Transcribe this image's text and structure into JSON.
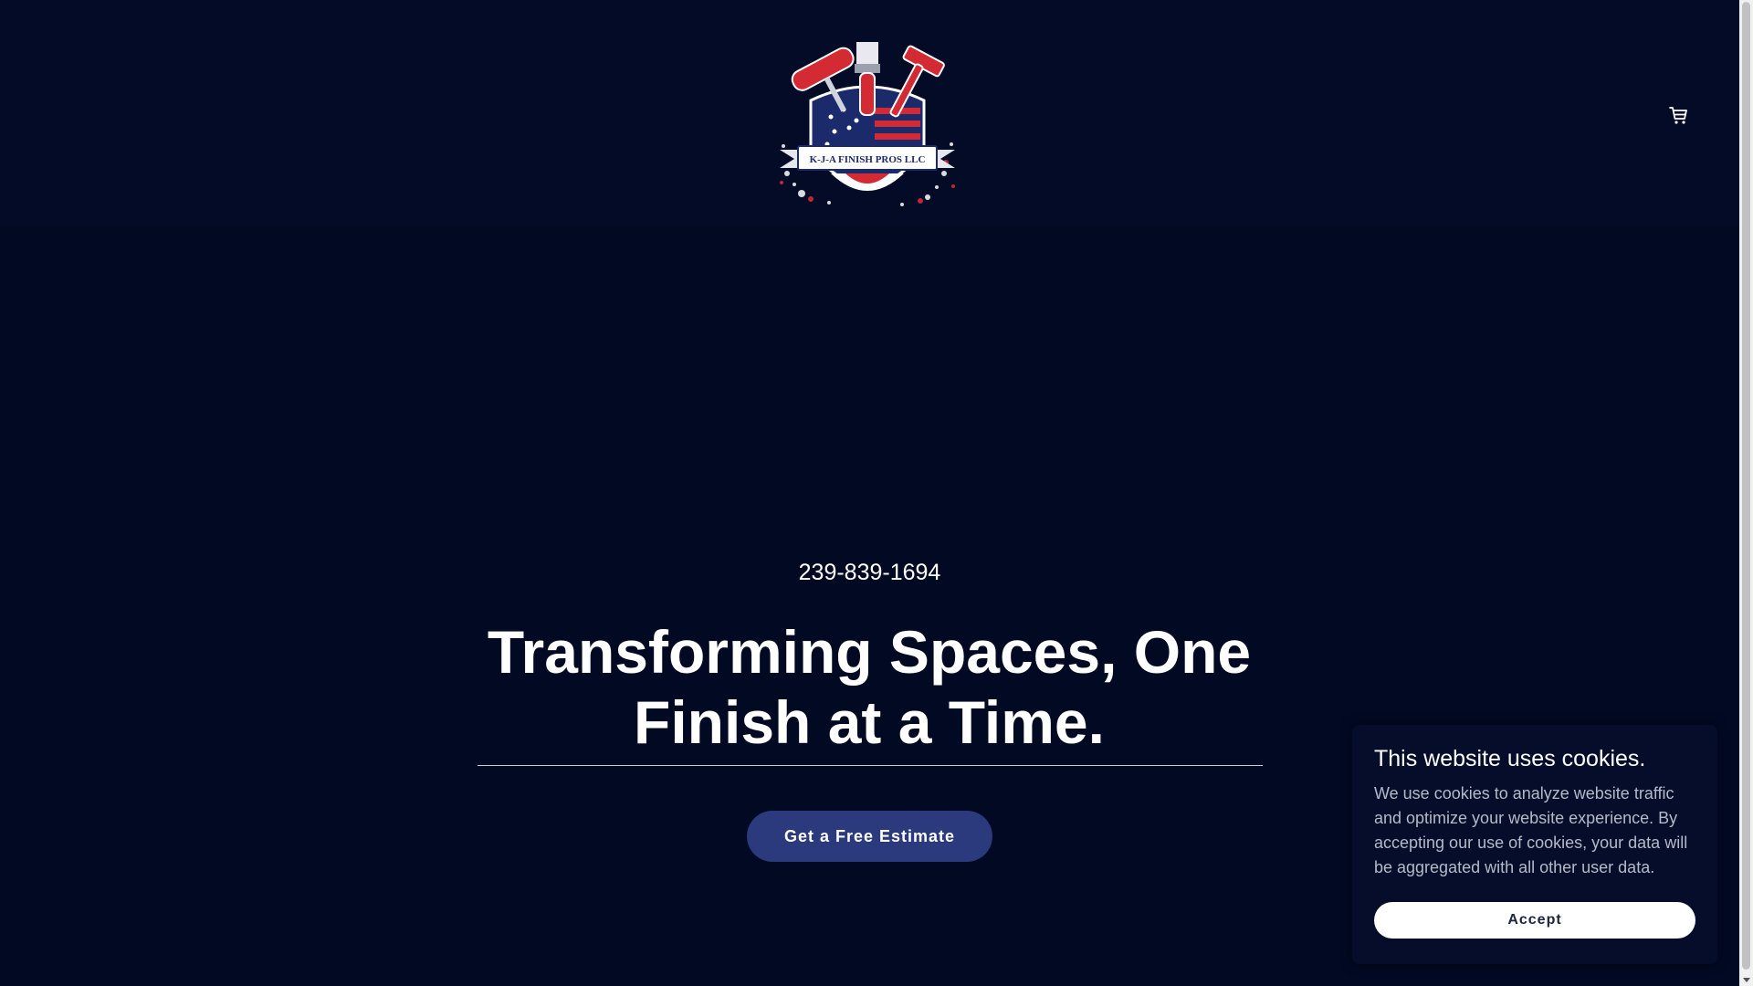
{
  "header": {
    "logo_text": "K-J-A FINISH PROS LLC",
    "cart_icon": "shopping-cart-icon"
  },
  "hero": {
    "phone": "239-839-1694",
    "headline": "Transforming Spaces, One Finish at a Time.",
    "cta_label": "Get a Free Estimate"
  },
  "cookie_banner": {
    "title": "This website uses cookies.",
    "text": "We use cookies to analyze website traffic and optimize your website experience. By accepting our use of cookies, your data will be aggregated with all other user data.",
    "accept_label": "Accept"
  },
  "colors": {
    "background": "#020922",
    "button": "#2a3a7c",
    "logo_red": "#d32a34",
    "logo_navy": "#1b2a6a"
  }
}
